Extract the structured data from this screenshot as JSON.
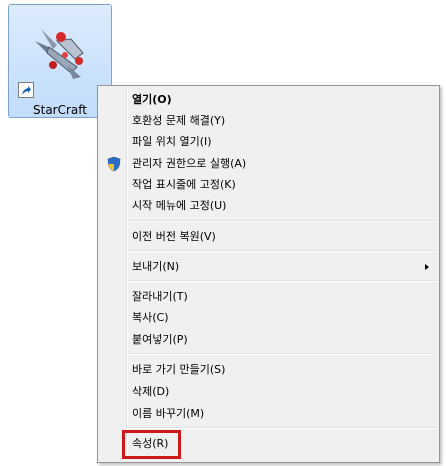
{
  "desktop_icon": {
    "label": "StarCraft"
  },
  "menu": {
    "open": "열기(O)",
    "compat_troubleshoot": "호환성 문제 해결(Y)",
    "open_file_location": "파일 위치 열기(I)",
    "run_as_admin": "관리자 권한으로 실행(A)",
    "pin_taskbar": "작업 표시줄에 고정(K)",
    "pin_start": "시작 메뉴에 고정(U)",
    "restore_previous": "이전 버전 복원(V)",
    "send_to": "보내기(N)",
    "cut": "잘라내기(T)",
    "copy": "복사(C)",
    "paste": "붙여넣기(P)",
    "create_shortcut": "바로 가기 만들기(S)",
    "delete": "삭제(D)",
    "rename": "이름 바꾸기(M)",
    "properties": "속성(R)"
  },
  "highlight_color": "#cc1a1a"
}
